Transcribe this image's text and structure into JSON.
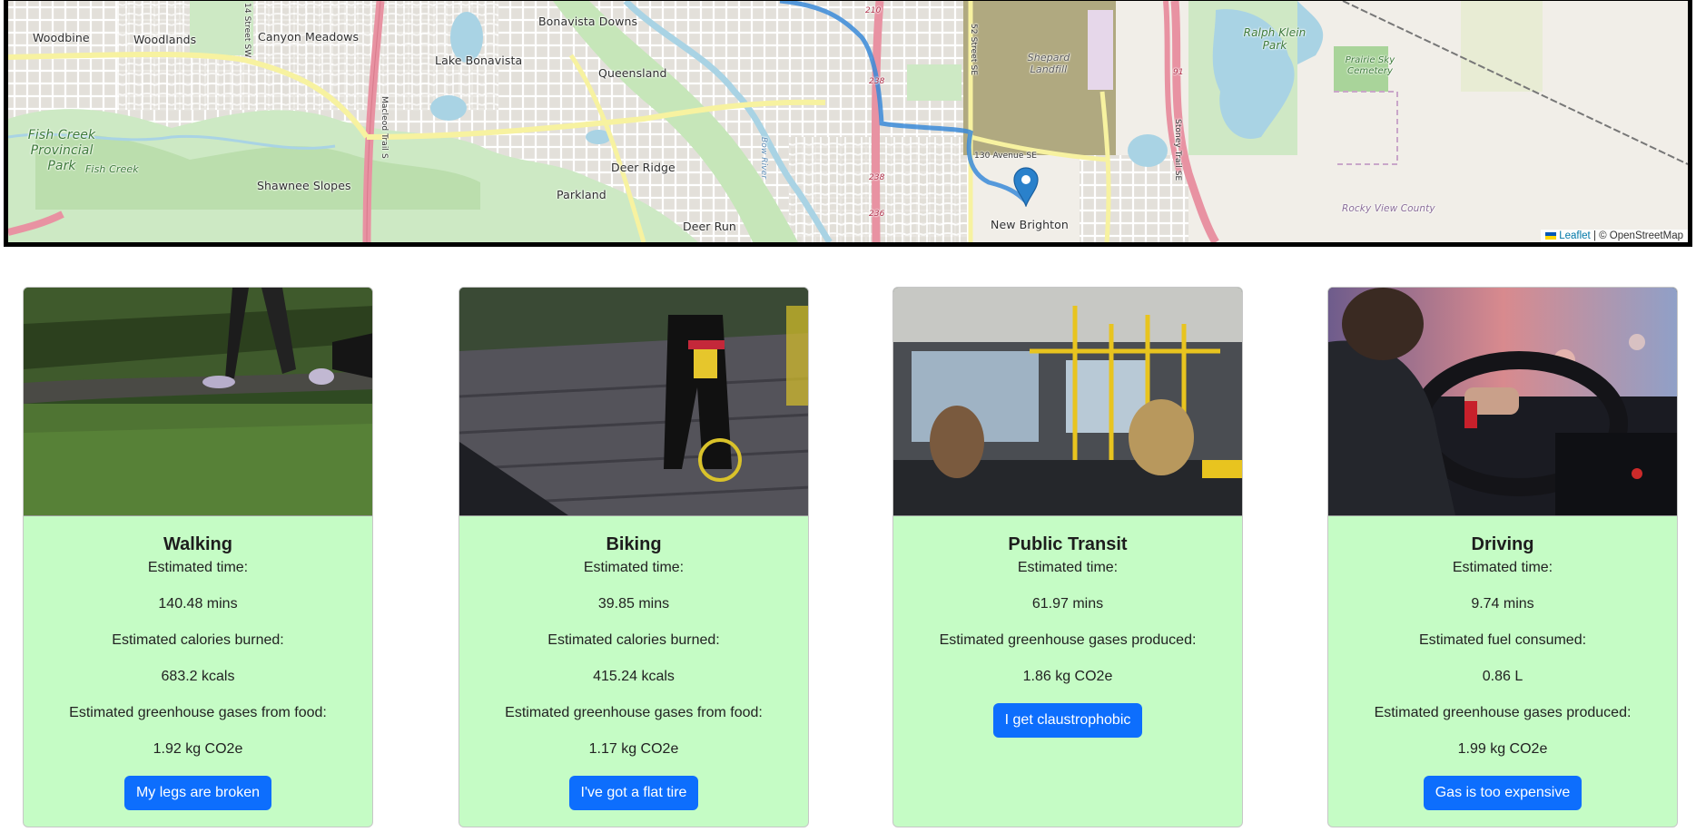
{
  "map": {
    "labels": {
      "woodbine": "Woodbine",
      "woodlands": "Woodlands",
      "canyon_meadows": "Canyon Meadows",
      "lake_bonavista": "Lake Bonavista",
      "bonavista_downs": "Bonavista Downs",
      "queensland": "Queensland",
      "deer_ridge": "Deer Ridge",
      "parkland": "Parkland",
      "deer_run": "Deer Run",
      "shawnee_slopes": "Shawnee Slopes",
      "fish_creek_park": "Fish Creek Provincial Park",
      "fish_creek": "Fish Creek",
      "new_brighton": "New Brighton",
      "shepard_landfill": "Shepard Landfill",
      "ralph_klein_park": "Ralph Klein Park",
      "prairie_sky_cemetery": "Prairie Sky Cemetery",
      "rocky_view_county": "Rocky View County",
      "road_14_street": "14 Street SW",
      "road_52_street": "52 Street SE",
      "road_130_avenue": "130 Avenue SE",
      "road_stoney_trail": "Stoney Trail SE",
      "road_bow_river": "Bow River",
      "road_macleod": "Macleod Trail S",
      "route_238": "238",
      "route_236": "236",
      "route_91": "91",
      "route_210": "210"
    },
    "attribution": {
      "leaflet": "Leaflet",
      "separator": "|",
      "osm": "© OpenStreetMap"
    },
    "marker_icon": "map-pin-icon",
    "route_color": "#4a90d9"
  },
  "cards": [
    {
      "title": "Walking",
      "image_icon": "walking-photo",
      "lines": [
        "Estimated time:",
        "140.48 mins",
        "Estimated calories burned:",
        "683.2 kcals",
        "Estimated greenhouse gases from food:",
        "1.92 kg CO2e"
      ],
      "button": "My legs are broken"
    },
    {
      "title": "Biking",
      "image_icon": "biking-photo",
      "lines": [
        "Estimated time:",
        "39.85 mins",
        "Estimated calories burned:",
        "415.24 kcals",
        "Estimated greenhouse gases from food:",
        "1.17 kg CO2e"
      ],
      "button": "I've got a flat tire"
    },
    {
      "title": "Public Transit",
      "image_icon": "transit-photo",
      "lines": [
        "Estimated time:",
        "61.97 mins",
        "Estimated greenhouse gases produced:",
        "1.86 kg CO2e"
      ],
      "button": "I get claustrophobic"
    },
    {
      "title": "Driving",
      "image_icon": "driving-photo",
      "lines": [
        "Estimated time:",
        "9.74 mins",
        "Estimated fuel consumed:",
        "0.86 L",
        "Estimated greenhouse gases produced:",
        "1.99 kg CO2e"
      ],
      "button": "Gas is too expensive"
    }
  ],
  "colors": {
    "card_bg": "#c5fcc5",
    "button_bg": "#0d6efd",
    "button_text": "#ffffff"
  }
}
